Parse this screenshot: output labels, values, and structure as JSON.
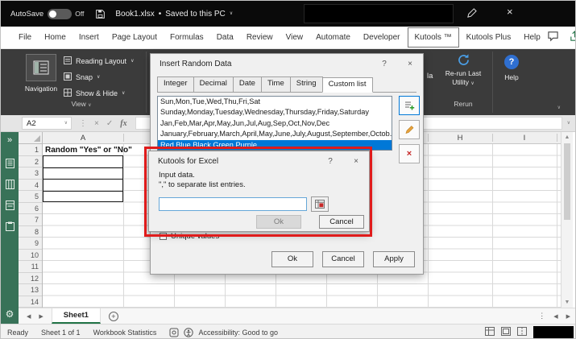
{
  "colors": {
    "accent_green": "#217346",
    "sidebar_green": "#387258",
    "ribbon_dark": "#3b3b3b",
    "selection_blue": "#0078d7",
    "annotation_red": "#e01b1b",
    "help_blue": "#2f6fd0"
  },
  "title_bar": {
    "autosave_label": "AutoSave",
    "autosave_state": "Off",
    "filename": "Book1.xlsx",
    "separator": "•",
    "saved_status": "Saved to this PC"
  },
  "tab_row": {
    "tabs": [
      "File",
      "Home",
      "Insert",
      "Page Layout",
      "Formulas",
      "Data",
      "Review",
      "View",
      "Automate",
      "Developer",
      "Kutools ™",
      "Kutools Plus",
      "Help"
    ],
    "active_tab": "Kutools ™"
  },
  "ribbon": {
    "navigation": "Navigation",
    "reading_layout": "Reading Layout",
    "snap": "Snap",
    "show_hide": "Show & Hide",
    "view_group": "View",
    "partial_text": "la",
    "rerun_line1": "Re-run Last",
    "rerun_line2": "Utility",
    "rerun_group": "Rerun",
    "help": "Help"
  },
  "formula_bar": {
    "name_box": "A2",
    "fx": "fx"
  },
  "sheet": {
    "columns": [
      "A",
      "H",
      "I"
    ],
    "rows": [
      "1",
      "2",
      "3",
      "4",
      "5",
      "6",
      "7",
      "8",
      "9",
      "10",
      "11",
      "12",
      "13",
      "14"
    ],
    "a1_value": "Random \"Yes\" or \"No\"",
    "sheet_tab": "Sheet1"
  },
  "insert_random_dialog": {
    "title": "Insert Random Data",
    "tabs": [
      "Integer",
      "Decimal",
      "Date",
      "Time",
      "String",
      "Custom list"
    ],
    "active_tab": "Custom list",
    "list_items": [
      "Sun,Mon,Tue,Wed,Thu,Fri,Sat",
      "Sunday,Monday,Tuesday,Wednesday,Thursday,Friday,Saturday",
      "Jan,Feb,Mar,Apr,May,Jun,Jul,Aug,Sep,Oct,Nov,Dec",
      "January,February,March,April,May,June,July,August,September,Octob...",
      "Red,Blue,Black,Green,Purple"
    ],
    "selected_item": "Red,Blue,Black,Green,Purple",
    "unique_values": "Unique values",
    "ok": "Ok",
    "cancel": "Cancel",
    "apply": "Apply"
  },
  "kutools_dialog": {
    "title": "Kutools for Excel",
    "line1": "Input data.",
    "line2": "\",\" to separate list entries.",
    "input_value": "",
    "ok": "Ok",
    "cancel": "Cancel"
  },
  "status_bar": {
    "ready": "Ready",
    "sheets": "Sheet 1 of 1",
    "workbook_statistics": "Workbook Statistics",
    "accessibility": "Accessibility: Good to go"
  },
  "glyphs": {
    "chevron_down": "∨",
    "close": "×",
    "check": "✓",
    "dots_v": "⋮",
    "collapse": "»",
    "gear": "⚙",
    "left": "◀",
    "right": "▶",
    "up": "▲",
    "down": "▼",
    "plus": "+",
    "help_q": "?"
  }
}
